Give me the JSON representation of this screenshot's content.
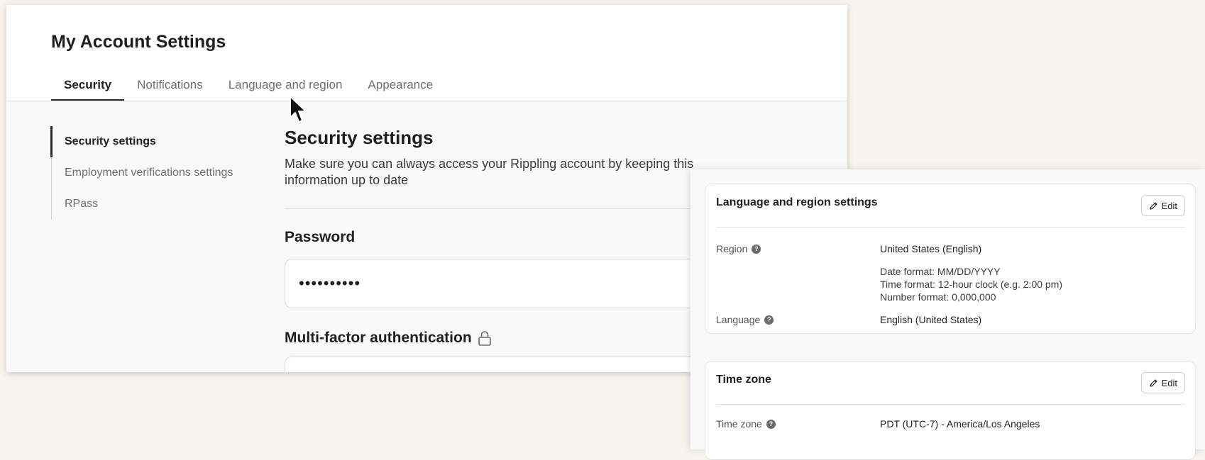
{
  "page": {
    "title": "My Account Settings"
  },
  "tabs": [
    {
      "label": "Security",
      "active": true
    },
    {
      "label": "Notifications",
      "active": false
    },
    {
      "label": "Language and region",
      "active": false
    },
    {
      "label": "Appearance",
      "active": false
    }
  ],
  "side_nav": [
    {
      "label": "Security settings",
      "active": true
    },
    {
      "label": "Employment verifications settings",
      "active": false
    },
    {
      "label": "RPass",
      "active": false
    }
  ],
  "security": {
    "title": "Security settings",
    "description": "Make sure you can always access your Rippling account by keeping this information up to date",
    "password_label": "Password",
    "password_value": "••••••••••",
    "mfa_label": "Multi-factor authentication",
    "mfa_icon": "lock-icon"
  },
  "language_region": {
    "title": "Language and region settings",
    "edit_label": "Edit",
    "region_label": "Region",
    "region_value": "United States (English)",
    "date_format": "Date format: MM/DD/YYYY",
    "time_format": "Time format: 12-hour clock (e.g. 2:00 pm)",
    "number_format": "Number format: 0,000,000",
    "language_label": "Language",
    "language_value": "English (United States)"
  },
  "time_zone": {
    "title": "Time zone",
    "edit_label": "Edit",
    "label": "Time zone",
    "value": "PDT (UTC-7) - America/Los Angeles"
  },
  "icons": {
    "help": "?",
    "edit": "pencil-icon",
    "pointer": "mouse-pointer-icon"
  },
  "colors": {
    "background": "#f7f3ef",
    "text": "#1f1f1f",
    "muted": "#6e6e6e",
    "active_indicator": "#2a2a2a"
  }
}
